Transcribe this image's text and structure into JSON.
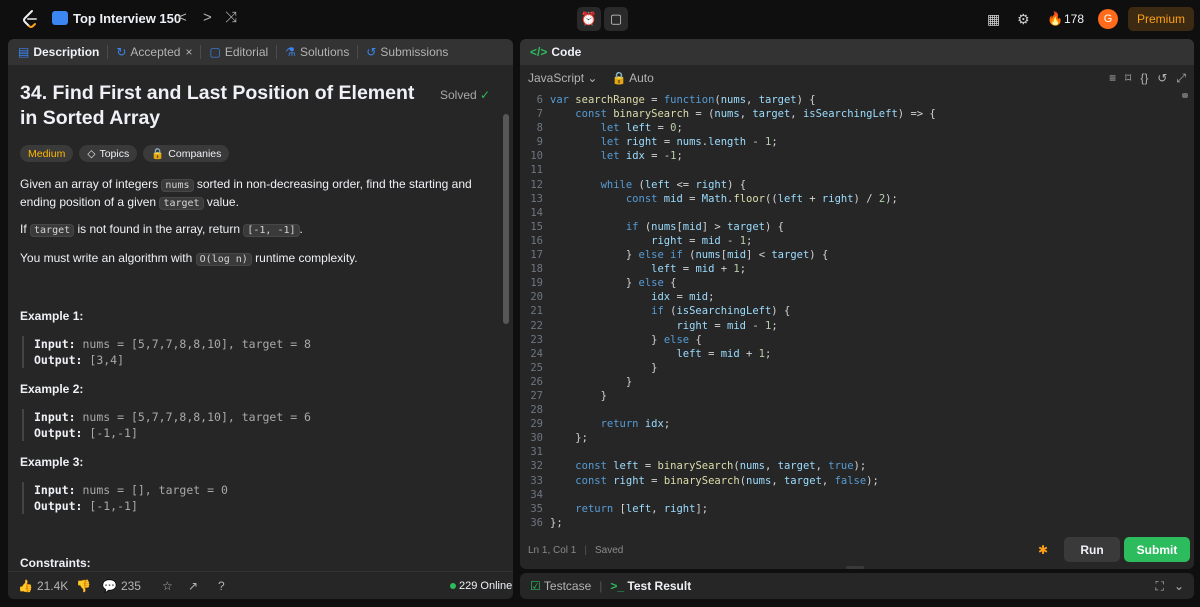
{
  "topbar": {
    "title": "Top Interview 150",
    "prev": "<",
    "next": ">",
    "shuffle": "⤨",
    "timer_icon": "⏰",
    "note_icon": "▢",
    "layout_icon": "▦",
    "settings_icon": "⚙",
    "fire_icon": "🔥",
    "streak": "178",
    "avatar_letter": "G",
    "premium": "Premium"
  },
  "left_tabs": [
    {
      "icon": "▤",
      "label": "Description"
    },
    {
      "icon": "↻",
      "label": "Accepted"
    },
    {
      "icon": "▢",
      "label": "Editorial"
    },
    {
      "icon": "⚗",
      "label": "Solutions"
    },
    {
      "icon": "↺",
      "label": "Submissions"
    }
  ],
  "close_tab": "×",
  "problem": {
    "title": "34. Find First and Last Position of Element in Sorted Array",
    "solved": "Solved",
    "solved_icon": "✓",
    "difficulty": "Medium",
    "topics": "Topics",
    "companies": "Companies",
    "desc1_a": "Given an array of integers ",
    "desc1_code1": "nums",
    "desc1_b": " sorted in non-decreasing order, find the starting and ending position of a given ",
    "desc1_code2": "target",
    "desc1_c": " value.",
    "desc2_a": "If ",
    "desc2_code1": "target",
    "desc2_b": " is not found in the array, return ",
    "desc2_code2": "[-1, -1]",
    "desc2_c": ".",
    "desc3_a": "You must write an algorithm with ",
    "desc3_code": "O(log n)",
    "desc3_b": " runtime complexity.",
    "examples": [
      {
        "heading": "Example 1:",
        "input": "nums = [5,7,7,8,8,10], target = 8",
        "output": "[3,4]"
      },
      {
        "heading": "Example 2:",
        "input": "nums = [5,7,7,8,8,10], target = 6",
        "output": "[-1,-1]"
      },
      {
        "heading": "Example 3:",
        "input": "nums = [], target = 0",
        "output": "[-1,-1]"
      }
    ],
    "input_label": "Input:",
    "output_label": "Output:",
    "constraints": "Constraints:"
  },
  "left_footer": {
    "likes": "21.4K",
    "comments": "235",
    "online": "229 Online"
  },
  "editor": {
    "tab": "Code",
    "tab_icon": "</>",
    "language": "JavaScript",
    "mode": "Auto",
    "status_pos": "Ln 1, Col 1",
    "status_saved": "Saved",
    "run": "Run",
    "submit": "Submit",
    "lines": [
      {
        "n": "6",
        "code": "var searchRange = function(nums, target) {"
      },
      {
        "n": "7",
        "code": "    const binarySearch = (nums, target, isSearchingLeft) => {"
      },
      {
        "n": "8",
        "code": "        let left = 0;"
      },
      {
        "n": "9",
        "code": "        let right = nums.length - 1;"
      },
      {
        "n": "10",
        "code": "        let idx = -1;"
      },
      {
        "n": "11",
        "code": ""
      },
      {
        "n": "12",
        "code": "        while (left <= right) {"
      },
      {
        "n": "13",
        "code": "            const mid = Math.floor((left + right) / 2);"
      },
      {
        "n": "14",
        "code": ""
      },
      {
        "n": "15",
        "code": "            if (nums[mid] > target) {"
      },
      {
        "n": "16",
        "code": "                right = mid - 1;"
      },
      {
        "n": "17",
        "code": "            } else if (nums[mid] < target) {"
      },
      {
        "n": "18",
        "code": "                left = mid + 1;"
      },
      {
        "n": "19",
        "code": "            } else {"
      },
      {
        "n": "20",
        "code": "                idx = mid;"
      },
      {
        "n": "21",
        "code": "                if (isSearchingLeft) {"
      },
      {
        "n": "22",
        "code": "                    right = mid - 1;"
      },
      {
        "n": "23",
        "code": "                } else {"
      },
      {
        "n": "24",
        "code": "                    left = mid + 1;"
      },
      {
        "n": "25",
        "code": "                }"
      },
      {
        "n": "26",
        "code": "            }"
      },
      {
        "n": "27",
        "code": "        }"
      },
      {
        "n": "28",
        "code": ""
      },
      {
        "n": "29",
        "code": "        return idx;"
      },
      {
        "n": "30",
        "code": "    };"
      },
      {
        "n": "31",
        "code": ""
      },
      {
        "n": "32",
        "code": "    const left = binarySearch(nums, target, true);"
      },
      {
        "n": "33",
        "code": "    const right = binarySearch(nums, target, false);"
      },
      {
        "n": "34",
        "code": ""
      },
      {
        "n": "35",
        "code": "    return [left, right];"
      },
      {
        "n": "36",
        "code": "};"
      }
    ]
  },
  "bottom": {
    "testcase": "Testcase",
    "test_result": "Test Result",
    "test_result_icon": ">_"
  },
  "colors": {
    "accent": "#2cbb5d",
    "brand": "#ffa116",
    "medium": "#ffb800"
  }
}
